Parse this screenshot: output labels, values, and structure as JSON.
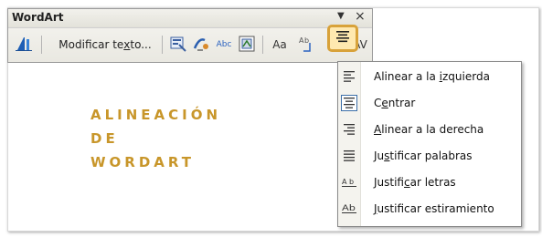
{
  "toolbar": {
    "title": "WordArt",
    "edit_text_pre": "Modificar te",
    "edit_text_mnemonic": "x",
    "edit_text_post": "to...",
    "icons": [
      "wordart-insert-icon",
      "wordart-gallery-icon",
      "format-wordart-icon",
      "wordart-shape-icon",
      "text-wrapping-icon",
      "same-letter-heights-icon",
      "vertical-text-icon",
      "alignment-icon",
      "character-spacing-icon"
    ],
    "letter_heights_glyph": "Aa",
    "spacing_glyph": "AV",
    "abc_glyph": "Abc"
  },
  "document": {
    "wordart_lines": [
      "ALINEACIÓN",
      "DE",
      "WORDART"
    ],
    "wordart_color": "#c8962a"
  },
  "menu": {
    "items": [
      {
        "pre": "Alinear a la ",
        "mn": "i",
        "post": "zquierda",
        "icon": "align-left-icon",
        "selected": false
      },
      {
        "pre": "C",
        "mn": "e",
        "post": "ntrar",
        "icon": "align-center-icon",
        "selected": true
      },
      {
        "pre": "",
        "mn": "A",
        "post": "linear a la derecha",
        "icon": "align-right-icon",
        "selected": false
      },
      {
        "pre": "Ju",
        "mn": "s",
        "post": "tificar palabras",
        "icon": "justify-words-icon",
        "selected": false
      },
      {
        "pre": "Justifi",
        "mn": "c",
        "post": "ar letras",
        "icon": "justify-letters-icon",
        "selected": false
      },
      {
        "pre": "",
        "mn": "J",
        "post": "ustificar estiramiento",
        "icon": "justify-stretch-icon",
        "selected": false
      }
    ],
    "letters_glyph": "A b",
    "stretch_glyph": "Ab"
  },
  "colors": {
    "accent": "#d8a23a",
    "wordart": "#c8962a",
    "selection_border": "#3b6ea8"
  }
}
